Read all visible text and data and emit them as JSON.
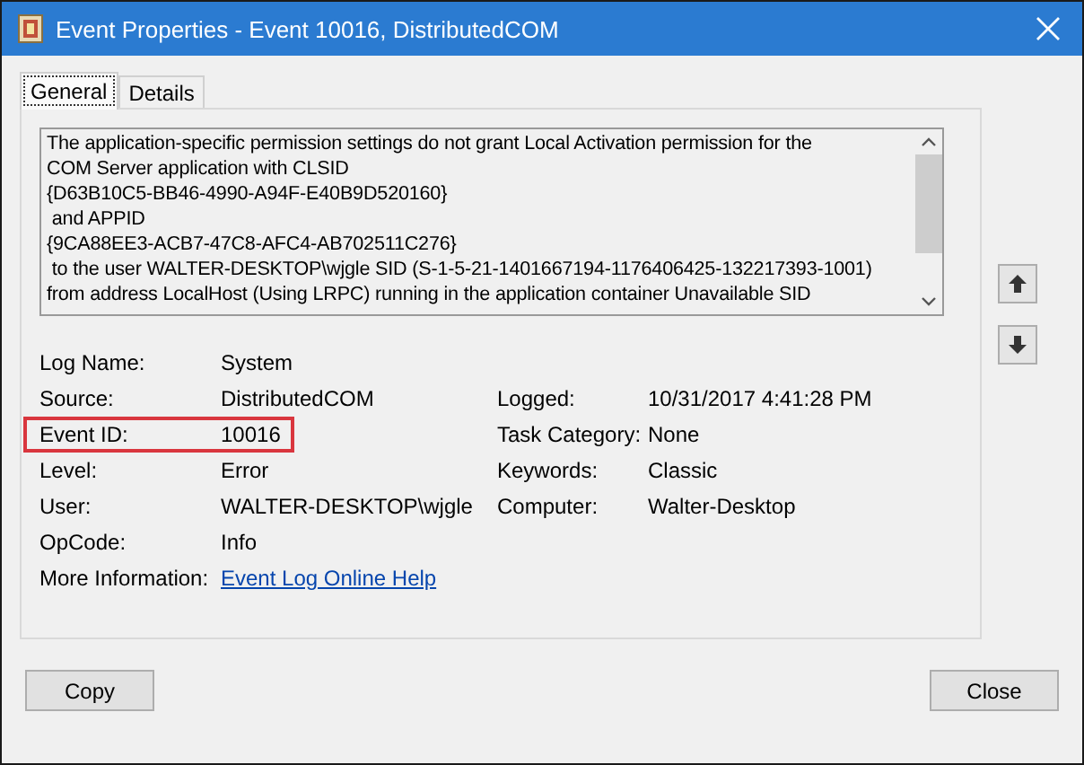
{
  "window": {
    "title": "Event Properties - Event 10016, DistributedCOM"
  },
  "tabs": [
    {
      "label": "General",
      "selected": true
    },
    {
      "label": "Details",
      "selected": false
    }
  ],
  "message": "The application-specific permission settings do not grant Local Activation permission for the\nCOM Server application with CLSID\n{D63B10C5-BB46-4990-A94F-E40B9D520160}\n and APPID\n{9CA88EE3-ACB7-47C8-AFC4-AB702511C276}\n to the user WALTER-DESKTOP\\wjgle SID (S-1-5-21-1401667194-1176406425-132217393-1001)\nfrom address LocalHost (Using LRPC) running in the application container Unavailable SID",
  "fields_left": [
    {
      "label": "Log Name:",
      "value": "System",
      "kind": "text",
      "highlighted": false
    },
    {
      "label": "Source:",
      "value": "DistributedCOM",
      "kind": "text",
      "highlighted": false
    },
    {
      "label": "Event ID:",
      "value": "10016",
      "kind": "text",
      "highlighted": true
    },
    {
      "label": "Level:",
      "value": "Error",
      "kind": "text",
      "highlighted": false
    },
    {
      "label": "User:",
      "value": "WALTER-DESKTOP\\wjgle",
      "kind": "text",
      "highlighted": false
    },
    {
      "label": "OpCode:",
      "value": "Info",
      "kind": "text",
      "highlighted": false
    },
    {
      "label": "More Information:",
      "value": "Event Log Online Help",
      "kind": "link",
      "highlighted": false
    }
  ],
  "fields_right": [
    {
      "label": "Logged:",
      "value": "10/31/2017 4:41:28 PM"
    },
    {
      "label": "Task Category:",
      "value": "None"
    },
    {
      "label": "Keywords:",
      "value": "Classic"
    },
    {
      "label": "Computer:",
      "value": "Walter-Desktop"
    }
  ],
  "buttons": [
    "Copy",
    "Close"
  ]
}
